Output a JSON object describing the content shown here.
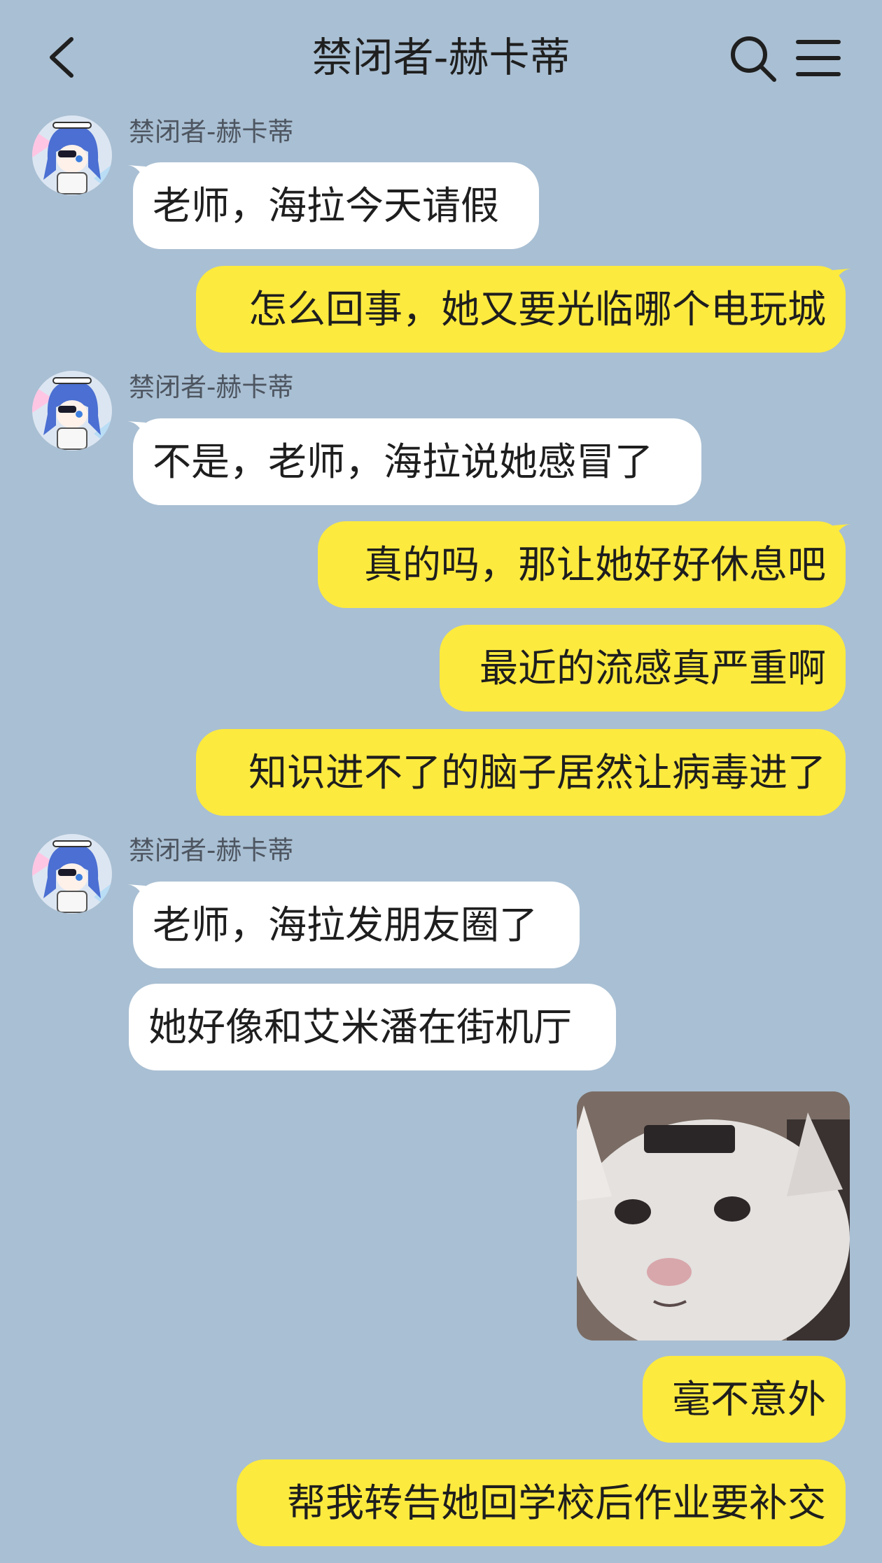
{
  "header": {
    "title": "禁闭者-赫卡蒂",
    "back_icon": "chevron-left-icon",
    "search_icon": "search-icon",
    "menu_icon": "menu-icon"
  },
  "colors": {
    "background": "#a9bfd3",
    "incoming_bubble": "#ffffff",
    "outgoing_bubble": "#fdea3e"
  },
  "messages": [
    {
      "side": "in",
      "sender": "禁闭者-赫卡蒂",
      "text": "老师，海拉今天请假"
    },
    {
      "side": "out",
      "text": "怎么回事，她又要光临哪个电玩城"
    },
    {
      "side": "in",
      "sender": "禁闭者-赫卡蒂",
      "text": "不是，老师，海拉说她感冒了"
    },
    {
      "side": "out",
      "text": "真的吗，那让她好好休息吧"
    },
    {
      "side": "out",
      "text": "最近的流感真严重啊"
    },
    {
      "side": "out",
      "text": "知识进不了的脑子居然让病毒进了"
    },
    {
      "side": "in",
      "sender": "禁闭者-赫卡蒂",
      "text": "老师，海拉发朋友圈了"
    },
    {
      "side": "in",
      "text": "她好像和艾米潘在街机厅"
    },
    {
      "side": "out",
      "type": "image",
      "image": "white-cat-face-sticker"
    },
    {
      "side": "out",
      "text": "毫不意外"
    },
    {
      "side": "out",
      "text": "帮我转告她回学校后作业要补交"
    }
  ]
}
